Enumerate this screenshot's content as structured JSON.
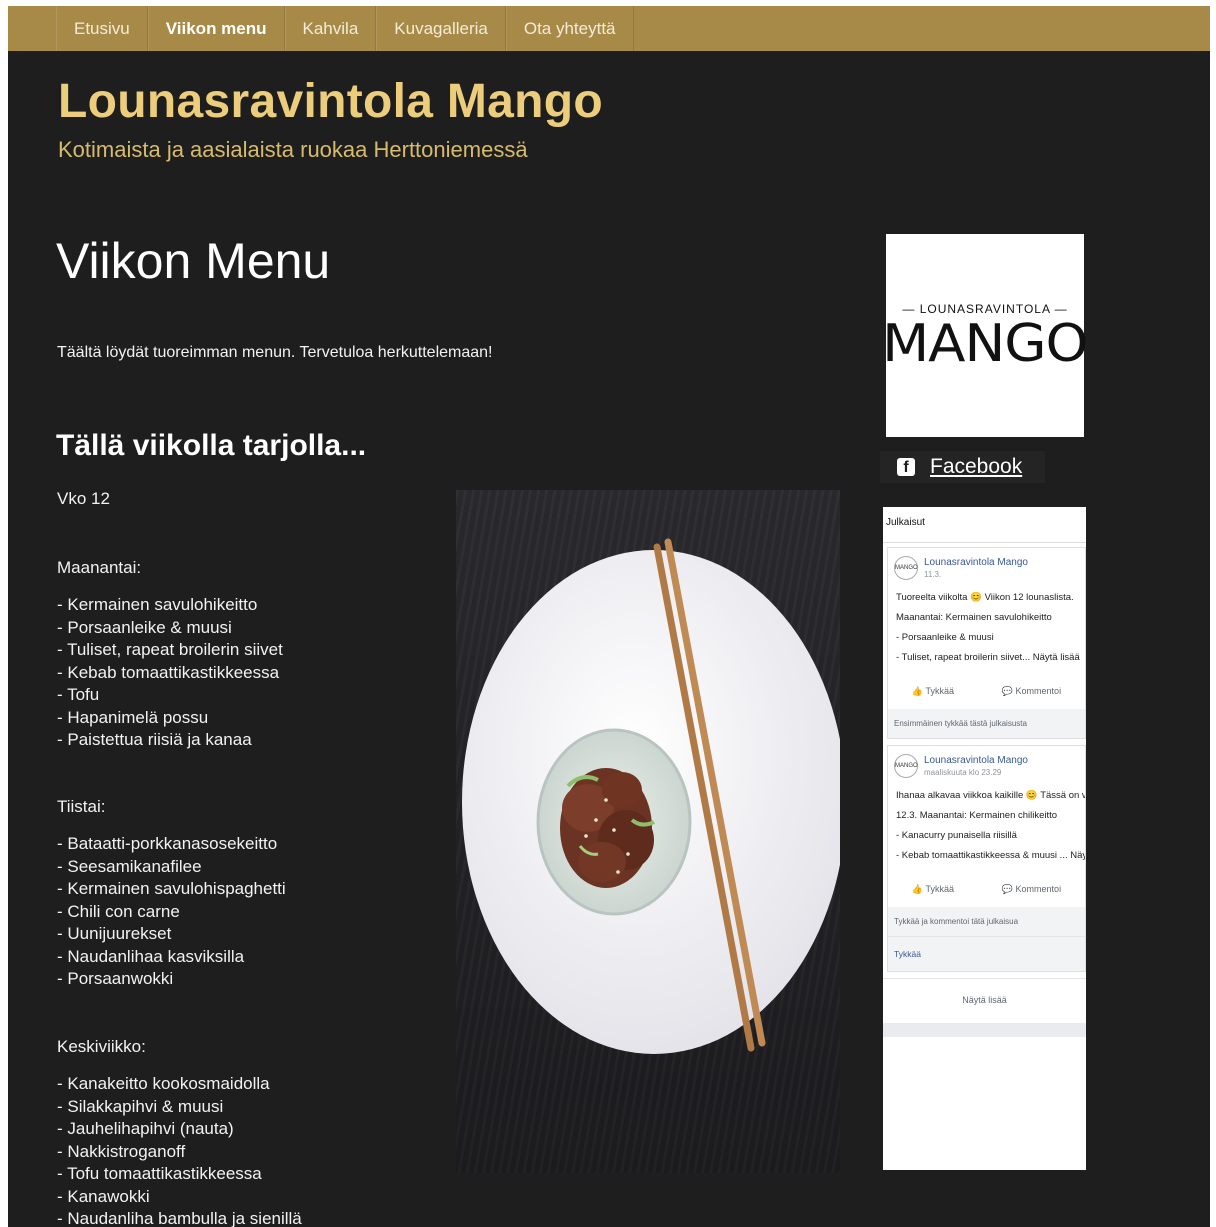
{
  "nav": {
    "items": [
      "Etusivu",
      "Viikon menu",
      "Kahvila",
      "Kuvagalleria",
      "Ota yhteyttä"
    ],
    "active": "Viikon menu"
  },
  "site": {
    "title": "Lounasravintola Mango",
    "subtitle": "Kotimaista ja aasialaista ruokaa Herttoniemessä"
  },
  "content": {
    "page_title": "Viikon Menu",
    "intro": "Täältä löydät tuoreimman menun. Tervetuloa herkuttelemaan!",
    "section_title": "Tällä viikolla tarjolla...",
    "week": "Vko 12",
    "days": [
      {
        "label": "Maanantai:",
        "items": [
          "- Kermainen savulohikeitto",
          "- Porsaanleike & muusi",
          "- Tuliset, rapeat broilerin siivet",
          "- Kebab tomaattikastikkeessa",
          "- Tofu",
          "- Hapanimelä possu",
          "- Paistettua riisiä ja kanaa"
        ]
      },
      {
        "label": "Tiistai:",
        "items": [
          "- Bataatti-porkkanasosekeitto",
          "- Seesamikanafilee",
          "- Kermainen savulohispaghetti",
          "- Chili con carne",
          "- Uunijuurekset",
          "- Naudanlihaa kasviksilla",
          "- Porsaanwokki"
        ]
      },
      {
        "label": "Keskiviikko:",
        "items": [
          "- Kanakeitto kookosmaidolla",
          "- Silakkapihvi & muusi",
          "- Jauhelihapihvi (nauta)",
          "- Nakkistroganoff",
          "- Tofu tomaattikastikkeessa",
          "- Kanawokki",
          "- Naudanliha bambulla ja sienillä"
        ]
      }
    ]
  },
  "sidebar": {
    "logo_top": "— LOUNASRAVINTOLA —",
    "logo_main": "MANGO",
    "facebook_label": "Facebook",
    "facebook_icon": "f",
    "widget": {
      "header": "Julkaisut",
      "posts": [
        {
          "author": "Lounasravintola Mango",
          "meta": "11.3.",
          "avatar_text": "MANGO",
          "lines": [
            "Tuoreelta viikolta 😊 Viikon 12 lounaslista.",
            "Maanantai: Kermainen savulohikeitto",
            "- Porsaanleike & muusi",
            "- Tuliset, rapeat broilerin siivet... Näytä lisää"
          ],
          "like": "Tykkää",
          "comment": "Kommentoi",
          "footer": "Ensimmäinen tykkää tästä julkaisusta"
        },
        {
          "author": "Lounasravintola Mango",
          "meta": "maaliskuuta klo 23.29",
          "avatar_text": "MANGO",
          "lines": [
            "Ihanaa alkavaa viikkoa kaikille 😊 Tässä on viikon ruokalista",
            "12.3. Maanantai: Kermainen chilikeitto",
            "- Kanacurry punaisella riisillä",
            "- Kebab tomaattikastikkeessa & muusi ... Näytä lisää"
          ],
          "like": "Tykkää",
          "comment": "Kommentoi",
          "footer": "Tykkää ja kommentoi tätä julkaisua",
          "footer2": "Tykkää"
        }
      ],
      "more": "Näytä lisää"
    }
  },
  "colors": {
    "nav_bg": "#a88a48",
    "page_bg": "#1e1e1e",
    "title_gold": "#eccd7c"
  }
}
